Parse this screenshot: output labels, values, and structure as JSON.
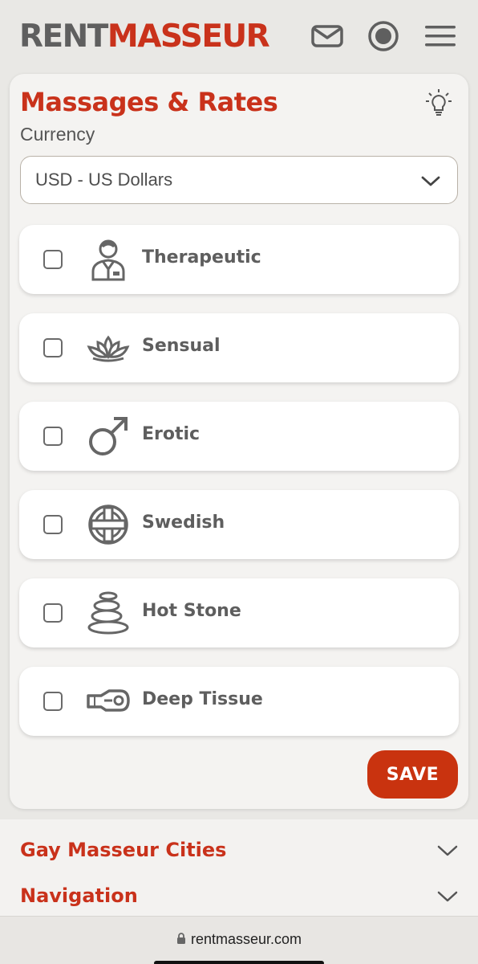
{
  "header": {
    "logo_part1": "RENT",
    "logo_part2": "MASSEUR",
    "icons": [
      "mail-icon",
      "record-icon",
      "menu-icon"
    ]
  },
  "rates_card": {
    "title": "Massages & Rates",
    "currency_label": "Currency",
    "currency_value": "USD - US Dollars",
    "massage_types": [
      {
        "label": "Therapeutic",
        "icon": "therapist-icon",
        "checked": false
      },
      {
        "label": "Sensual",
        "icon": "lotus-icon",
        "checked": false
      },
      {
        "label": "Erotic",
        "icon": "male-symbol-icon",
        "checked": false
      },
      {
        "label": "Swedish",
        "icon": "swedish-icon",
        "checked": false
      },
      {
        "label": "Hot Stone",
        "icon": "stones-icon",
        "checked": false
      },
      {
        "label": "Deep Tissue",
        "icon": "fist-icon",
        "checked": false
      }
    ],
    "save_label": "SAVE"
  },
  "footer": {
    "sections": [
      "Gay Masseur Cities",
      "Navigation"
    ]
  },
  "browser": {
    "url": "rentmasseur.com"
  },
  "colors": {
    "brand_red": "#c9321b",
    "logo_gray": "#5f5f5f",
    "save_button": "#c9330f",
    "background": "#e9e8e5"
  }
}
